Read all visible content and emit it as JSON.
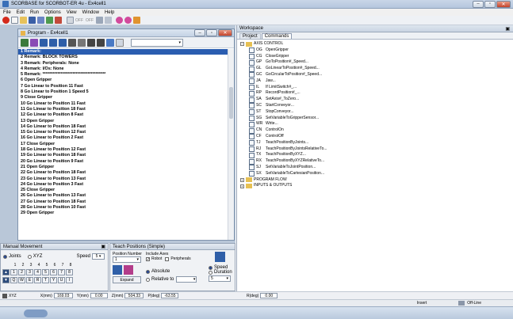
{
  "window": {
    "title": "SCORBASE for SCORBOT-ER 4u - Ex4cell1"
  },
  "menu": [
    "File",
    "Edit",
    "Run",
    "Options",
    "View",
    "Window",
    "Help"
  ],
  "toolbar": {
    "off_label": "OFF",
    "off2_label": "OFF"
  },
  "program_window": {
    "title": "Program - Ex4cell1",
    "lines": [
      "1 Remark:",
      "2 Remark: BLOCK TOWERS",
      "3 Remark: Peripherals: None",
      "4 Remark: I/Os: None",
      "5 Remark: **************************************",
      "6 Open Gripper",
      "7 Go Linear to Position 11 Fast",
      "8 Go Linear to Position 1 Speed 5",
      "9 Close Gripper",
      "10 Go Linear to Position 11 Fast",
      "11 Go Linear to Position 18 Fast",
      "12 Go Linear to Position 8 Fast",
      "13 Open Gripper",
      "14 Go Linear to Position 18 Fast",
      "15 Go Linear to Position 12 Fast",
      "16 Go Linear to Position 2 Fast",
      "17 Close Gripper",
      "18 Go Linear to Position 12 Fast",
      "19 Go Linear to Position 18 Fast",
      "20 Go Linear to Position 9 Fast",
      "21 Open Gripper",
      "22 Go Linear to Position 18 Fast",
      "23 Go Linear to Position 13 Fast",
      "24 Go Linear to Position 3 Fast",
      "25 Close Gripper",
      "26 Go Linear to Position 13 Fast",
      "27 Go Linear to Position 18 Fast",
      "28 Go Linear to Position 10 Fast",
      "29 Open Gripper"
    ]
  },
  "manual_movement": {
    "title": "Manual Movement",
    "joints_label": "Joints",
    "xyz_label": "XYZ",
    "speed_label": "Speed",
    "speed_value": "5",
    "numbers": [
      "1",
      "2",
      "3",
      "4",
      "5",
      "6",
      "7",
      "8"
    ],
    "keys_top": [
      "1",
      "2",
      "3",
      "4",
      "5",
      "6",
      "7",
      "8"
    ],
    "keys_bottom": [
      "Q",
      "W",
      "E",
      "R",
      "T",
      "Y",
      "U",
      "I"
    ]
  },
  "teach_positions": {
    "title": "Teach Positions (Simple)",
    "position_number_label": "Position Number",
    "position_number_value": "1",
    "include_axes_label": "Include Axes",
    "robot_label": "Robot",
    "peripherals_label": "Peripherals",
    "absolute_label": "Absolute",
    "relative_label": "Relative to",
    "expand_label": "Expand",
    "speed_label": "Speed",
    "duration_label": "Duration",
    "speed_value": "5"
  },
  "coords": {
    "mode_label": "XYZ",
    "x_label": "X(mm)",
    "x_value": "169.03",
    "y_label": "Y(mm)",
    "y_value": "0.00",
    "z_label": "Z(mm)",
    "z_value": "504.33",
    "p_label": "P(deg)",
    "p_value": "-63.55",
    "r_label": "R(deg)",
    "r_value": "0.00"
  },
  "workspace": {
    "title": "Workspace",
    "tabs": [
      "Project",
      "Commands"
    ],
    "root_label": "AXIS CONTROL",
    "commands": [
      {
        "code": "OG",
        "name": "OpenGripper"
      },
      {
        "code": "CG",
        "name": "CloseGripper"
      },
      {
        "code": "GP",
        "name": "GoToPosition#_Speed..."
      },
      {
        "code": "GL",
        "name": "GoLinearToPosition#_Speed..."
      },
      {
        "code": "GC",
        "name": "GoCircularToPosition#_Speed..."
      },
      {
        "code": "JA",
        "name": "Jaw..."
      },
      {
        "code": "IL",
        "name": "If LimitSwitch#_..."
      },
      {
        "code": "RP",
        "name": "RecordPosition#_..."
      },
      {
        "code": "SA",
        "name": "SetAxis#_ToZero..."
      },
      {
        "code": "SC",
        "name": "StartConveyor..."
      },
      {
        "code": "ST",
        "name": "StopConveyor..."
      },
      {
        "code": "SG",
        "name": "SetVariableToGripperSensor..."
      },
      {
        "code": "WR",
        "name": "Write..."
      },
      {
        "code": "CN",
        "name": "ControlOn"
      },
      {
        "code": "CF",
        "name": "ControlOff"
      },
      {
        "code": "TJ",
        "name": "TeachPositionByJoints..."
      },
      {
        "code": "RJ",
        "name": "TeachPositionByJointsRelativeTo..."
      },
      {
        "code": "TX",
        "name": "TeachPositionByXYZ..."
      },
      {
        "code": "RX",
        "name": "TeachPositionByXYZRelativeTo..."
      },
      {
        "code": "SJ",
        "name": "SetVariableToJointPosition..."
      },
      {
        "code": "SX",
        "name": "SetVariableToCartesianPosition..."
      }
    ],
    "folders": [
      "PROGRAM FLOW",
      "INPUTS & OUTPUTS"
    ]
  },
  "status": {
    "mode": "Insert",
    "line_state": "Off-Line"
  },
  "colors": {
    "selection": "#2a5db0",
    "panel_bg": "#dfe6ef",
    "title_gradient_top": "#e4eaf2"
  }
}
